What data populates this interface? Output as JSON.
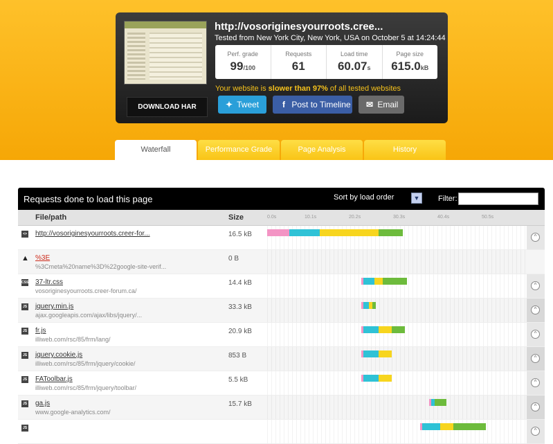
{
  "summary": {
    "url": "http://vosoriginesyourroots.cree...",
    "tested": "Tested from New York City, New York, USA on October 5 at 14:24:44",
    "stats": [
      {
        "label": "Perf. grade",
        "value": "99",
        "unit": "/100"
      },
      {
        "label": "Requests",
        "value": "61",
        "unit": ""
      },
      {
        "label": "Load time",
        "value": "60.07",
        "unit": "s"
      },
      {
        "label": "Page size",
        "value": "615.0",
        "unit": "kB"
      }
    ],
    "slower_prefix": "Your website is ",
    "slower_bold": "slower than 97%",
    "slower_suffix": " of all tested websites",
    "download_label": "DOWNLOAD HAR",
    "tweet_label": "Tweet",
    "timeline_label": "Post to Timeline",
    "email_label": "Email"
  },
  "tabs": [
    "Waterfall",
    "Performance Grade",
    "Page Analysis",
    "History"
  ],
  "panel": {
    "title": "Requests done to load this page",
    "sort_label": "Sort by load order",
    "filter_label": "Filter:",
    "col_file": "File/path",
    "col_size": "Size",
    "ticks": [
      "0.0s",
      "10.1s",
      "20.2s",
      "30.3s",
      "40.4s",
      "50.5s"
    ]
  },
  "rows": [
    {
      "type": "html",
      "name": "http://vosoriginesyourroots.creer-for...",
      "path": "",
      "size": "16.5 kB",
      "segments": [
        {
          "start": 0,
          "dur": 5.0,
          "color": "#f394c4"
        },
        {
          "start": 5.0,
          "dur": 7.0,
          "color": "#2fc2d6"
        },
        {
          "start": 12.0,
          "dur": 13.5,
          "color": "#f7d51e"
        },
        {
          "start": 25.5,
          "dur": 5.5,
          "color": "#6dbb3c"
        }
      ]
    },
    {
      "type": "warn",
      "name": "%3E",
      "path": "%3Cmeta%20name%3D%22google-site-verif...",
      "size": "0 B",
      "segments": []
    },
    {
      "type": "css",
      "name": "37-ltr.css",
      "path": "vosoriginesyourroots.creer-forum.ca/",
      "size": "14.4 kB",
      "segments": [
        {
          "start": 21.5,
          "dur": 0.5,
          "color": "#f394c4"
        },
        {
          "start": 22.0,
          "dur": 2.5,
          "color": "#2fc2d6"
        },
        {
          "start": 24.5,
          "dur": 2.0,
          "color": "#f7d51e"
        },
        {
          "start": 26.5,
          "dur": 5.5,
          "color": "#6dbb3c"
        }
      ]
    },
    {
      "type": "js",
      "name": "jquery.min.js",
      "path": "ajax.googleapis.com/ajax/libs/jquery/...",
      "size": "33.3 kB",
      "segments": [
        {
          "start": 21.5,
          "dur": 0.5,
          "color": "#f394c4"
        },
        {
          "start": 22.0,
          "dur": 1.2,
          "color": "#2fc2d6"
        },
        {
          "start": 23.2,
          "dur": 0.8,
          "color": "#f7d51e"
        },
        {
          "start": 24.0,
          "dur": 0.8,
          "color": "#6dbb3c"
        }
      ]
    },
    {
      "type": "js",
      "name": "fr.js",
      "path": "illiweb.com/rsc/85/frm/lang/",
      "size": "20.9 kB",
      "segments": [
        {
          "start": 21.5,
          "dur": 0.5,
          "color": "#f394c4"
        },
        {
          "start": 22.0,
          "dur": 3.5,
          "color": "#2fc2d6"
        },
        {
          "start": 25.5,
          "dur": 3.0,
          "color": "#f7d51e"
        },
        {
          "start": 28.5,
          "dur": 3.0,
          "color": "#6dbb3c"
        }
      ]
    },
    {
      "type": "js",
      "name": "jquery.cookie.js",
      "path": "illiweb.com/rsc/85/frm/jquery/cookie/",
      "size": "853 B",
      "segments": [
        {
          "start": 21.5,
          "dur": 0.5,
          "color": "#f394c4"
        },
        {
          "start": 22.0,
          "dur": 3.5,
          "color": "#2fc2d6"
        },
        {
          "start": 25.5,
          "dur": 3.0,
          "color": "#f7d51e"
        }
      ]
    },
    {
      "type": "js",
      "name": "FAToolbar.js",
      "path": "illiweb.com/rsc/85/frm/jquery/toolbar/",
      "size": "5.5 kB",
      "segments": [
        {
          "start": 21.5,
          "dur": 0.5,
          "color": "#f394c4"
        },
        {
          "start": 22.0,
          "dur": 3.5,
          "color": "#2fc2d6"
        },
        {
          "start": 25.5,
          "dur": 3.0,
          "color": "#f7d51e"
        }
      ]
    },
    {
      "type": "js",
      "name": "ga.js",
      "path": "www.google-analytics.com/",
      "size": "15.7 kB",
      "segments": [
        {
          "start": 37.0,
          "dur": 0.5,
          "color": "#f394c4"
        },
        {
          "start": 37.5,
          "dur": 0.8,
          "color": "#2fc2d6"
        },
        {
          "start": 38.3,
          "dur": 2.7,
          "color": "#6dbb3c"
        }
      ]
    },
    {
      "type": "js",
      "name": "",
      "path": "",
      "size": "",
      "segments": [
        {
          "start": 35.0,
          "dur": 0.5,
          "color": "#f394c4"
        },
        {
          "start": 35.5,
          "dur": 4.0,
          "color": "#2fc2d6"
        },
        {
          "start": 39.5,
          "dur": 3.0,
          "color": "#f7d51e"
        },
        {
          "start": 42.5,
          "dur": 7.5,
          "color": "#6dbb3c"
        }
      ]
    }
  ]
}
